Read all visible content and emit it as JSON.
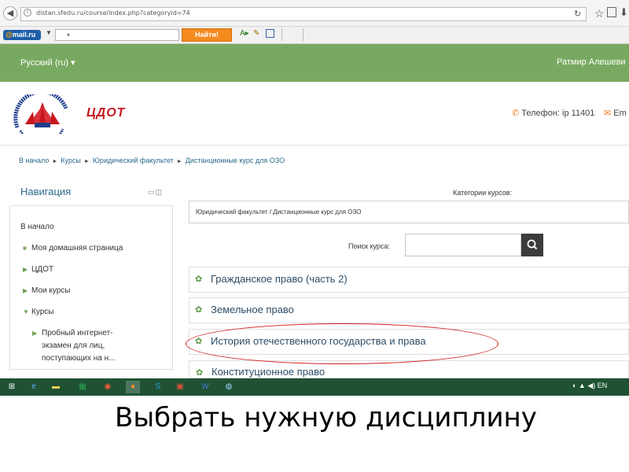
{
  "browser": {
    "url": "distan.sfedu.ru/course/index.php?categoryid=74"
  },
  "mailru_toolbar": {
    "logo": "mail.ru",
    "search_button": "Найти!"
  },
  "site_header": {
    "language": "Русский (ru) ▾",
    "user": "Ратмир Алешеви"
  },
  "branding": {
    "title": "ЦДОТ",
    "phone": "Телефон: ip 11401",
    "email": "Em"
  },
  "breadcrumb": [
    "В начало",
    "Курсы",
    "Юридический факультет",
    "Дистанционные курс для ОЗО"
  ],
  "navigation": {
    "title": "Навигация",
    "home": "В начало",
    "items": [
      {
        "label": "Моя домашняя страница",
        "marker": "■"
      },
      {
        "label": "ЦДОТ",
        "marker": "▶"
      },
      {
        "label": "Мои курсы",
        "marker": "▶"
      },
      {
        "label": "Курсы",
        "marker": "▼"
      }
    ],
    "subitem": [
      "Пробный интернет-",
      "экзамен для лиц,",
      "поступающих на н..."
    ]
  },
  "main": {
    "categories_label": "Категории курсов:",
    "category_value": "Юридический факультет / Дистанционные курс для ОЗО",
    "search_label": "Поиск курса:",
    "courses": [
      "Гражданское право (часть 2)",
      "Земельное право",
      "История отечественного государства и права",
      "Конституционное право"
    ]
  },
  "taskbar": {
    "tray_text": "EN"
  },
  "caption": "Выбрать нужную дисциплину",
  "colors": {
    "header_green": "#78a961",
    "accent_red": "#c8161d",
    "link_blue": "#2b6a8a",
    "taskbar": "#1f5233"
  }
}
